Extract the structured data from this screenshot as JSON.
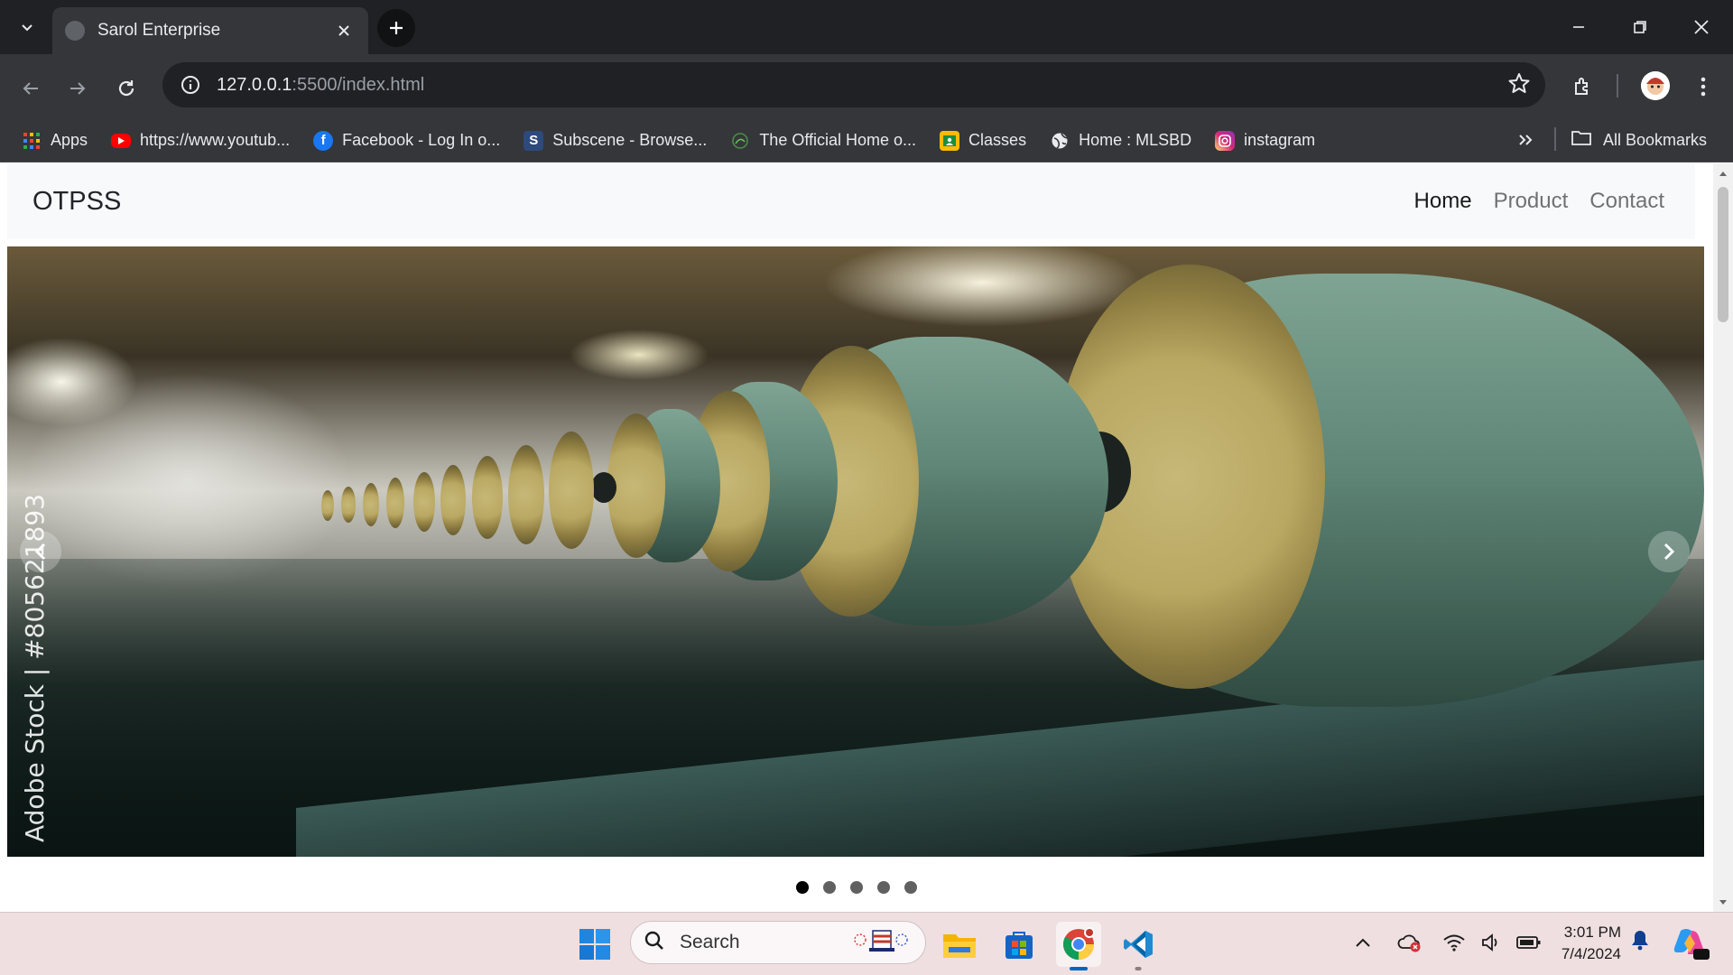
{
  "browser": {
    "tab_title": "Sarol Enterprise",
    "url_host": "127.0.0.1",
    "url_path": ":5500/index.html",
    "bookmarks": [
      {
        "label": "Apps",
        "icon": "apps-grid-icon"
      },
      {
        "label": "https://www.youtub...",
        "icon": "youtube-icon"
      },
      {
        "label": "Facebook - Log In o...",
        "icon": "facebook-icon"
      },
      {
        "label": "Subscene - Browse...",
        "icon": "subscene-icon"
      },
      {
        "label": "The Official Home o...",
        "icon": "globe-green-icon"
      },
      {
        "label": "Classes",
        "icon": "classroom-icon"
      },
      {
        "label": "Home : MLSBD",
        "icon": "globe-icon"
      },
      {
        "label": "instagram",
        "icon": "instagram-icon"
      }
    ],
    "all_bookmarks": "All Bookmarks"
  },
  "site": {
    "brand": "OTPSS",
    "nav": [
      {
        "label": "Home",
        "active": true
      },
      {
        "label": "Product",
        "active": false
      },
      {
        "label": "Contact",
        "active": false
      }
    ],
    "carousel": {
      "watermark": "Adobe Stock | #805621893",
      "active_slide": 1,
      "slide_count": 5
    }
  },
  "taskbar": {
    "search_label": "Search",
    "time": "3:01 PM",
    "date": "7/4/2024"
  },
  "colors": {
    "accent": "#0067c0",
    "chrome_bg": "#35363a",
    "taskbar_bg": "#efdfe0"
  }
}
